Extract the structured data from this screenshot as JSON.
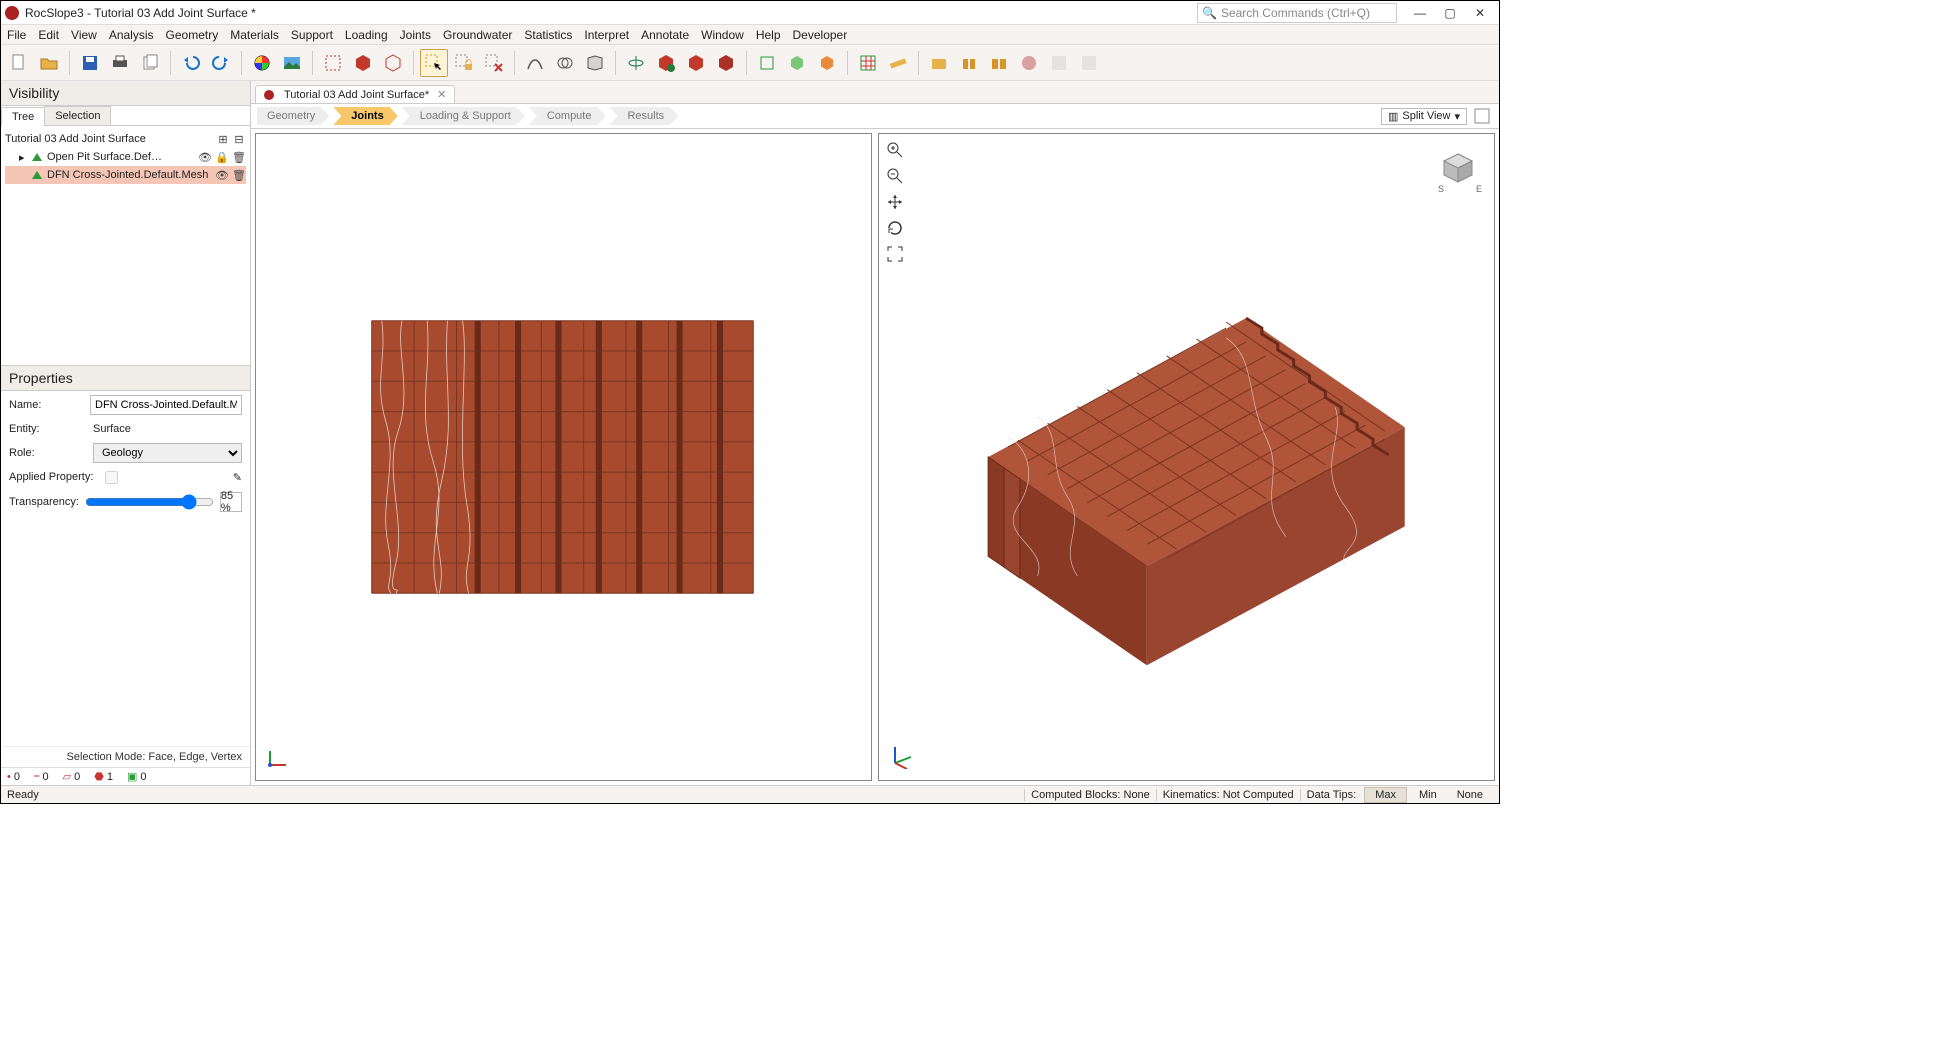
{
  "window": {
    "title": "RocSlope3 - Tutorial 03 Add Joint Surface *"
  },
  "search": {
    "placeholder": "Search Commands (Ctrl+Q)"
  },
  "menu": [
    "File",
    "Edit",
    "View",
    "Analysis",
    "Geometry",
    "Materials",
    "Support",
    "Loading",
    "Joints",
    "Groundwater",
    "Statistics",
    "Interpret",
    "Annotate",
    "Window",
    "Help",
    "Developer"
  ],
  "file_tab": {
    "label": "Tutorial 03 Add Joint Surface*"
  },
  "workflow": {
    "steps": [
      "Geometry",
      "Joints",
      "Loading & Support",
      "Compute",
      "Results"
    ],
    "active": "Joints"
  },
  "view_selector": "Split View",
  "visibility": {
    "title": "Visibility",
    "tabs": [
      "Tree",
      "Selection"
    ],
    "active_tab": "Tree",
    "root": "Tutorial 03 Add Joint Surface",
    "items": [
      {
        "label": "Open Pit Surface.Default.Mesh_ext",
        "selected": false
      },
      {
        "label": "DFN Cross-Jointed.Default.Mesh",
        "selected": true
      }
    ]
  },
  "properties": {
    "title": "Properties",
    "name_label": "Name:",
    "name_value": "DFN Cross-Jointed.Default.Mesh",
    "entity_label": "Entity:",
    "entity_value": "Surface",
    "role_label": "Role:",
    "role_value": "Geology",
    "applied_label": "Applied Property:",
    "applied_value": "",
    "transparency_label": "Transparency:",
    "transparency_value": "85 %"
  },
  "selmode": "Selection Mode: Face, Edge, Vertex",
  "counts": {
    "a": "0",
    "b": "0",
    "c": "0",
    "d": "1",
    "e": "0"
  },
  "status": {
    "ready": "Ready",
    "blocks_label": "Computed Blocks:",
    "blocks_value": "None",
    "kin_label": "Kinematics:",
    "kin_value": "Not Computed",
    "tips_label": "Data Tips:",
    "max": "Max",
    "min": "Min",
    "none": "None"
  }
}
